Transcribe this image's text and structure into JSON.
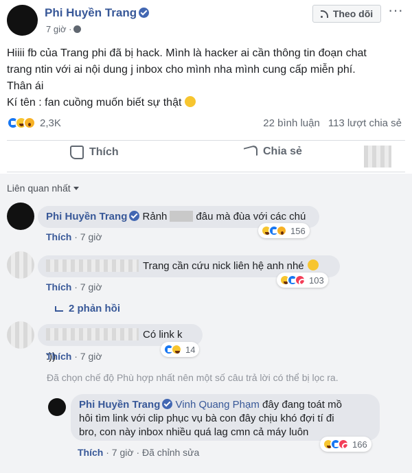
{
  "post": {
    "author": "Phi Huyền Trang",
    "time": "7 giờ",
    "follow_label": "Theo dõi",
    "more_icon": "more-icon",
    "text_lines": [
      "Hiiii fb của Trang phi đã bị hack. Mình là hacker ai cần thông tin đoạn chat",
      "trang ntin với ai nội dung j inbox cho mình nha mình cung cấp miễn phí.",
      "Thân ái",
      "Kí tên : fan cuồng muốn biết sự thật"
    ],
    "reaction_count": "2,3K",
    "comments_count": "22 bình luận",
    "shares_count": "113 lượt chia sẻ",
    "like_label": "Thích",
    "share_label": "Chia sẻ"
  },
  "comments_section": {
    "sort_label": "Liên quan nhất",
    "filter_note": "Đã chọn chế độ Phù hợp nhất nên một số câu trả lời có thể bị lọc ra.",
    "comments": [
      {
        "author": "Phi Huyền Trang",
        "text_before": "Rảnh",
        "text_after": "đâu mà đùa với các chú",
        "like_label": "Thích",
        "time": "7 giờ",
        "reaction_count": "156"
      },
      {
        "author": "",
        "text": "Trang cần cứu nick liên hệ anh nhé",
        "like_label": "Thích",
        "time": "7 giờ",
        "reaction_count": "103",
        "replies_label": "2 phản hồi"
      },
      {
        "author": "",
        "text": "Có link k :))",
        "like_label": "Thích",
        "time": "7 giờ",
        "reaction_count": "14"
      },
      {
        "author": "Phi Huyền Trang",
        "mention": "Vinh Quang Phạm",
        "text_lines": [
          "đây đang toát mồ",
          "hôi tìm link với clip phục vụ bà con đây chịu khó đợi tí đi",
          "bro, con này inbox nhiều quá lag cmn cả máy luôn"
        ],
        "like_label": "Thích",
        "time": "7 giờ",
        "edited_label": "Đã chỉnh sửa",
        "reaction_count": "166"
      }
    ]
  },
  "colors": {
    "link_blue": "#385898",
    "verified_blue": "#4267b2",
    "muted_text": "#606770",
    "comment_bubble": "#e4e6eb",
    "comments_background": "#f2f3f5"
  }
}
